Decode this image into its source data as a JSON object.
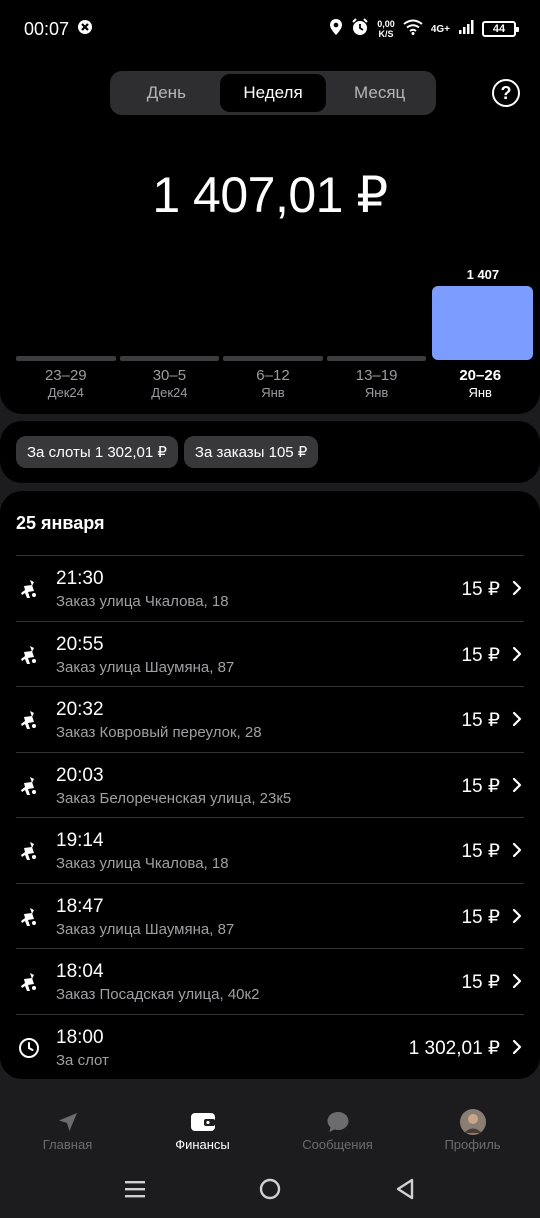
{
  "status_bar": {
    "time": "00:07",
    "net_speed_value": "0,00",
    "net_speed_unit": "K/S",
    "network_type": "4G+",
    "battery": "44"
  },
  "period_tabs": [
    {
      "label": "День",
      "active": false
    },
    {
      "label": "Неделя",
      "active": true
    },
    {
      "label": "Месяц",
      "active": false
    }
  ],
  "total_amount": "1 407,01 ₽",
  "chart_data": {
    "type": "bar",
    "categories": [
      "23–29 Дек24",
      "30–5 Дек24",
      "6–12 Янв",
      "13–19 Янв",
      "20–26 Янв"
    ],
    "weeks": [
      {
        "range": "23–29",
        "month": "Дек24",
        "value": 0,
        "active": false
      },
      {
        "range": "30–5",
        "month": "Дек24",
        "value": 0,
        "active": false
      },
      {
        "range": "6–12",
        "month": "Янв",
        "value": 0,
        "active": false
      },
      {
        "range": "13–19",
        "month": "Янв",
        "value": 0,
        "active": false
      },
      {
        "range": "20–26",
        "month": "Янв",
        "value": 1407,
        "active": true
      }
    ],
    "values": [
      0,
      0,
      0,
      0,
      1407
    ],
    "value_labels": [
      "",
      "",
      "",
      "",
      "1 407"
    ],
    "bar_color": "#7c9cff"
  },
  "chips": [
    {
      "label": "За слоты 1 302,01 ₽"
    },
    {
      "label": "За заказы 105 ₽"
    }
  ],
  "list": {
    "date": "25 января",
    "rows": [
      {
        "icon": "courier-icon",
        "time": "21:30",
        "desc": "Заказ улица Чкалова, 18",
        "amount": "15 ₽"
      },
      {
        "icon": "courier-icon",
        "time": "20:55",
        "desc": "Заказ улица Шаумяна, 87",
        "amount": "15 ₽"
      },
      {
        "icon": "courier-icon",
        "time": "20:32",
        "desc": "Заказ Ковровый переулок, 28",
        "amount": "15 ₽"
      },
      {
        "icon": "courier-icon",
        "time": "20:03",
        "desc": "Заказ Белореченская улица, 23к5",
        "amount": "15 ₽"
      },
      {
        "icon": "courier-icon",
        "time": "19:14",
        "desc": "Заказ улица Чкалова, 18",
        "amount": "15 ₽"
      },
      {
        "icon": "courier-icon",
        "time": "18:47",
        "desc": "Заказ улица Шаумяна, 87",
        "amount": "15 ₽"
      },
      {
        "icon": "courier-icon",
        "time": "18:04",
        "desc": "Заказ Посадская улица, 40к2",
        "amount": "15 ₽"
      },
      {
        "icon": "clock-icon",
        "time": "18:00",
        "desc": "За слот",
        "amount": "1 302,01 ₽"
      }
    ]
  },
  "bottom_nav": [
    {
      "label": "Главная",
      "icon": "navigation-arrow-icon",
      "active": false
    },
    {
      "label": "Финансы",
      "icon": "wallet-icon",
      "active": true
    },
    {
      "label": "Сообщения",
      "icon": "chat-bubble-icon",
      "active": false
    },
    {
      "label": "Профиль",
      "icon": "avatar",
      "active": false
    }
  ],
  "colors": {
    "background": "#000000",
    "accent_bar": "#7c9cff",
    "muted_text": "#9c9ca0"
  }
}
